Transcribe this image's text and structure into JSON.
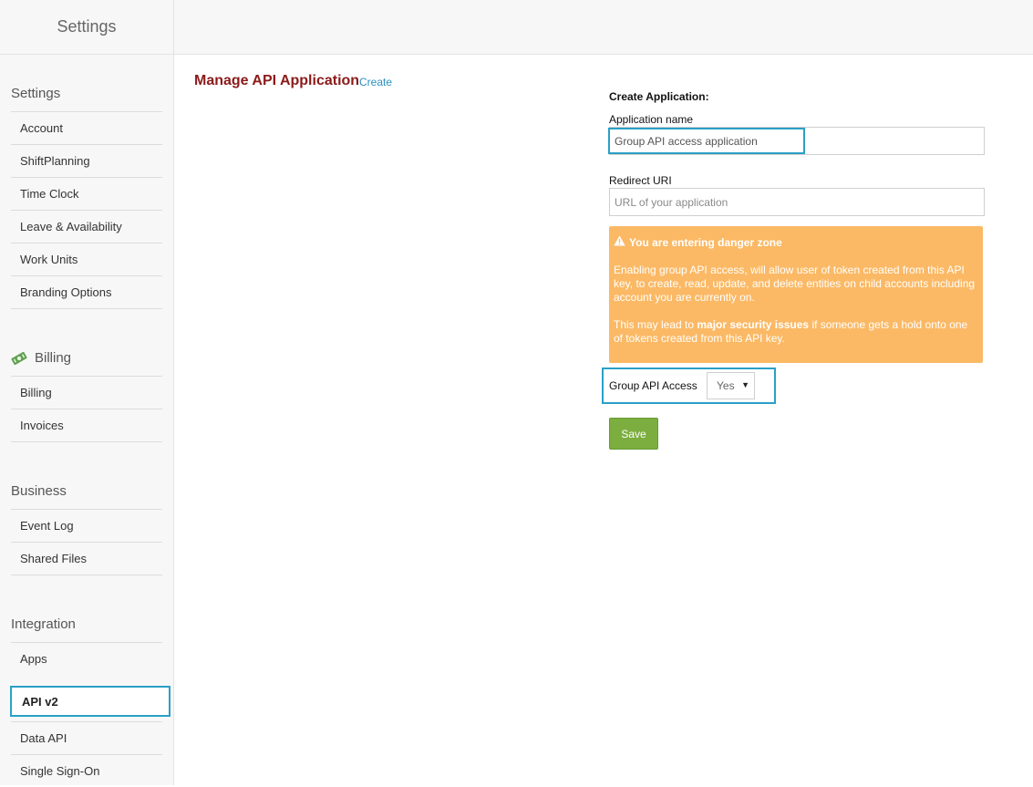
{
  "topbar": {
    "title": "Settings"
  },
  "sidebar": {
    "sections": [
      {
        "heading": "Settings",
        "items": [
          "Account",
          "ShiftPlanning",
          "Time Clock",
          "Leave & Availability",
          "Work Units",
          "Branding Options"
        ]
      },
      {
        "heading": "Billing",
        "icon": "money-icon",
        "items": [
          "Billing",
          "Invoices"
        ]
      },
      {
        "heading": "Business",
        "items": [
          "Event Log",
          "Shared Files"
        ]
      },
      {
        "heading": "Integration",
        "items": [
          "Apps",
          "API v2",
          "Data API",
          "Single Sign-On"
        ],
        "active": "API v2"
      }
    ]
  },
  "main": {
    "title": "Manage API Application",
    "create_link": "Create",
    "form": {
      "heading": "Create Application:",
      "app_name_label": "Application name",
      "app_name_value": "Group API access application",
      "redirect_label": "Redirect URI",
      "redirect_placeholder": "URL of your application",
      "danger": {
        "title": "You are entering danger zone",
        "paragraph1": "Enabling group API access, will allow user of token created from this API key, to create, read, update, and delete entities on child accounts including account you are currently on.",
        "paragraph2_prefix": "This may lead to ",
        "paragraph2_bold": "major security issues",
        "paragraph2_suffix": " if someone gets a hold onto one of tokens created from this API key."
      },
      "group_access_label": "Group API Access",
      "group_access_value": "Yes",
      "save_label": "Save"
    }
  },
  "colors": {
    "accent": "#2aa0c6",
    "title_red": "#8b1a1a",
    "danger_bg": "#fbb965",
    "save_green": "#7cae3f"
  }
}
